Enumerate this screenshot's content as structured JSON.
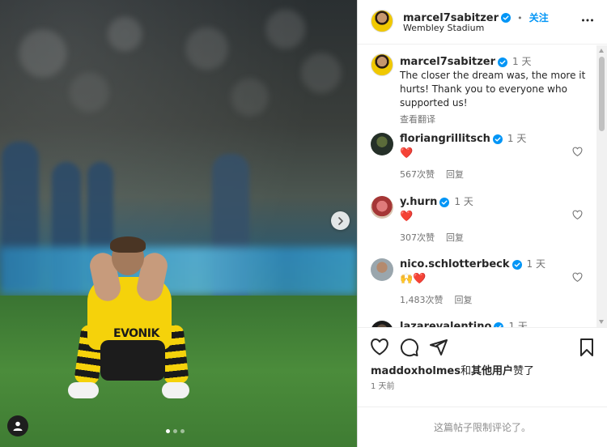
{
  "post": {
    "username": "marcel7sabitzer",
    "follow_label": "关注",
    "separator": "•",
    "location": "Wembley Stadium",
    "caption": "The closer the dream was, the more it hurts! Thank you to everyone who supported us!",
    "caption_time": "1 天",
    "translate_label": "查看翻译",
    "media_text": "EVONIK",
    "carousel": {
      "total": 3,
      "current": 1
    }
  },
  "comments": [
    {
      "username": "floriangrillitsch",
      "time": "1 天",
      "emoji": "❤️",
      "likes": "567次赞",
      "reply": "回复"
    },
    {
      "username": "y.hurn",
      "time": "1 天",
      "emoji": "❤️",
      "likes": "307次赞",
      "reply": "回复"
    },
    {
      "username": "nico.schlotterbeck",
      "time": "1 天",
      "emoji": "🙌❤️",
      "likes": "1,483次赞",
      "reply": "回复"
    },
    {
      "username": "lazarevalentino",
      "time": "1 天"
    }
  ],
  "likes_line": {
    "first_user": "maddoxholmes",
    "connector": "和",
    "others": "其他用户",
    "suffix": "赞了"
  },
  "posted_time": "1 天前",
  "comments_disabled": "这篇帖子限制评论了。",
  "colors": {
    "accent": "#0095f6",
    "verified": "#0095f6",
    "heart": "#ed4956",
    "muted": "#737373"
  }
}
